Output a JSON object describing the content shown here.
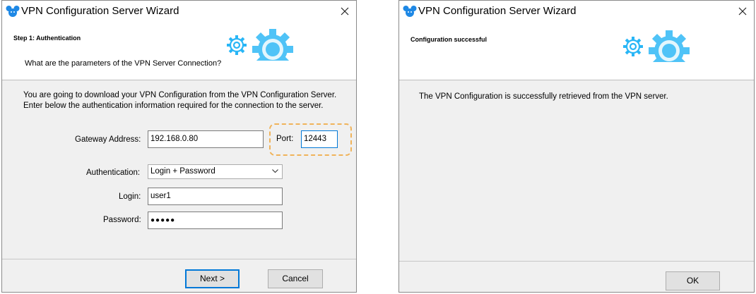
{
  "wizard_auth": {
    "window_title": "VPN Configuration Server Wizard",
    "step_title": "Step 1: Authentication",
    "question": "What are the parameters of the VPN Server Connection?",
    "intro_line1": "You are going to download your VPN Configuration from the VPN Configuration Server.",
    "intro_line2": "Enter below the authentication information required for the connection to the server.",
    "gateway_label": "Gateway Address:",
    "gateway_value": "192.168.0.80",
    "port_label": "Port:",
    "port_value": "12443",
    "auth_label": "Authentication:",
    "auth_value": "Login + Password",
    "login_label": "Login:",
    "login_value": "user1",
    "password_label": "Password:",
    "password_value": "●●●●●",
    "next_label": "Next >",
    "cancel_label": "Cancel"
  },
  "wizard_done": {
    "window_title": "VPN Configuration Server Wizard",
    "step_title": "Configuration successful",
    "message": "The VPN Configuration is successfully retrieved from the VPN server.",
    "ok_label": "OK"
  },
  "colors": {
    "accent_blue": "#0078d7",
    "gear_blue": "#4fc3f7",
    "highlight_orange": "#f0b35a"
  },
  "icons": {
    "app": "tgb-mouse-icon",
    "close": "close-icon",
    "header_art": "gears-icon",
    "dropdown": "chevron-down-icon"
  }
}
